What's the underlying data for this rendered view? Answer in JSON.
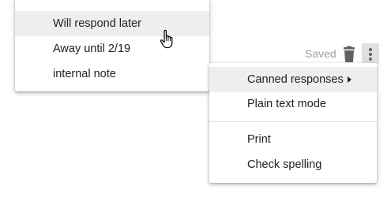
{
  "submenu": {
    "items": [
      {
        "label": "Will respond later",
        "hovered": true
      },
      {
        "label": "Away until 2/19"
      },
      {
        "label": "internal note"
      }
    ]
  },
  "toolbar": {
    "saved_label": "Saved",
    "icons": [
      "trash-icon",
      "more-options-icon"
    ]
  },
  "menu": {
    "items": [
      {
        "label": "Canned responses",
        "has_submenu": true,
        "hovered": true
      },
      {
        "label": "Plain text mode"
      },
      {
        "label": "Print"
      },
      {
        "label": "Check spelling"
      }
    ]
  },
  "colors": {
    "hover_bg": "#eeeeee",
    "muted_text": "#9e9e9e",
    "icon_gray": "#5f6368"
  }
}
